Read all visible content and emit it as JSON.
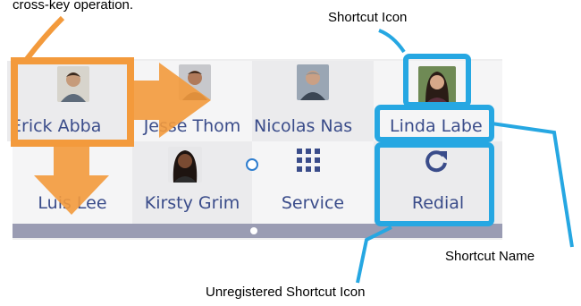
{
  "captions": {
    "top_left": "cross-key operation.",
    "shortcut_icon": "Shortcut Icon",
    "shortcut_name": "Shortcut Name",
    "unregistered": "Unregistered Shortcut Icon"
  },
  "shortcuts": {
    "row1": [
      "Erick Abba",
      "Jesse Thom",
      "Nicolas Nas",
      "Linda Labe"
    ],
    "row2": [
      "Luis Lee",
      "Kirsty Grim",
      "Service",
      "Redial"
    ]
  },
  "icons": {
    "service": "grid-icon",
    "redial": "redial-icon"
  },
  "colors": {
    "orange": "#f39a3c",
    "blue": "#26a7e2",
    "name_text": "#3a4c8a"
  }
}
